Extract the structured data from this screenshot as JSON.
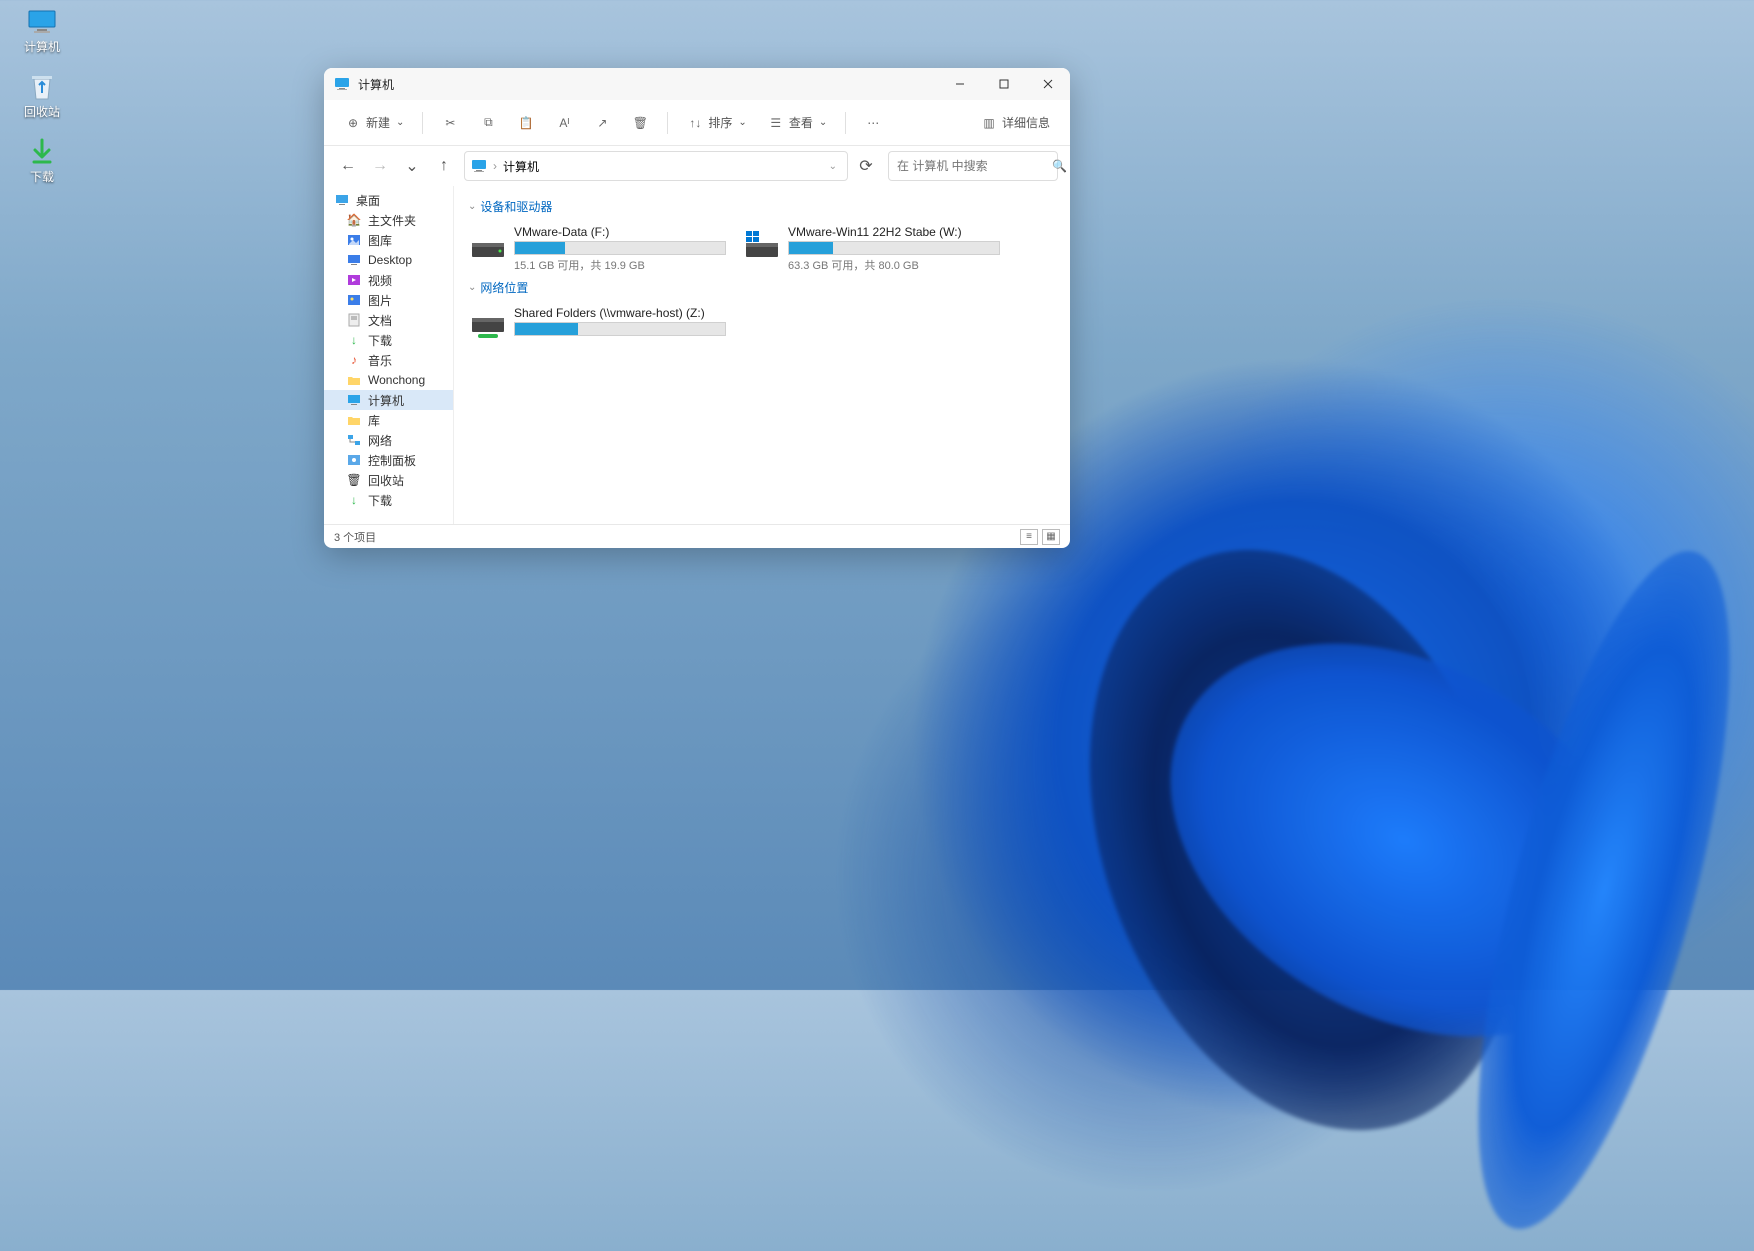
{
  "desktop": {
    "icons": [
      {
        "name": "computer",
        "label": "计算机"
      },
      {
        "name": "recycle-bin",
        "label": "回收站"
      },
      {
        "name": "downloads",
        "label": "下载"
      }
    ]
  },
  "window": {
    "title": "计算机",
    "toolbar": {
      "new_label": "新建",
      "sort_label": "排序",
      "view_label": "查看",
      "details_label": "详细信息"
    },
    "address": {
      "location": "计算机",
      "search_placeholder": "在 计算机 中搜索"
    },
    "sidebar": {
      "items": [
        {
          "label": "桌面",
          "icon": "desktop",
          "root": true
        },
        {
          "label": "主文件夹",
          "icon": "home"
        },
        {
          "label": "图库",
          "icon": "gallery"
        },
        {
          "label": "Desktop",
          "icon": "desktop2"
        },
        {
          "label": "视频",
          "icon": "video"
        },
        {
          "label": "图片",
          "icon": "pictures"
        },
        {
          "label": "文档",
          "icon": "documents"
        },
        {
          "label": "下载",
          "icon": "down"
        },
        {
          "label": "音乐",
          "icon": "music"
        },
        {
          "label": "Wonchong",
          "icon": "folder"
        },
        {
          "label": "计算机",
          "icon": "computer",
          "selected": true
        },
        {
          "label": "库",
          "icon": "library"
        },
        {
          "label": "网络",
          "icon": "network"
        },
        {
          "label": "控制面板",
          "icon": "control"
        },
        {
          "label": "回收站",
          "icon": "recycle"
        },
        {
          "label": "下载",
          "icon": "down"
        }
      ]
    },
    "groups": [
      {
        "header": "设备和驱动器",
        "drives": [
          {
            "name": "VMware-Data (F:)",
            "sub": "15.1 GB 可用，共 19.9 GB",
            "fill": 24,
            "icon": "disk"
          },
          {
            "name": "VMware-Win11 22H2 Stabe (W:)",
            "sub": "63.3 GB 可用，共 80.0 GB",
            "fill": 21,
            "icon": "windisk"
          }
        ]
      },
      {
        "header": "网络位置",
        "drives": [
          {
            "name": "Shared Folders (\\\\vmware-host) (Z:)",
            "sub": "",
            "fill": 30,
            "icon": "netdisk"
          }
        ]
      }
    ],
    "status": "3 个项目"
  }
}
